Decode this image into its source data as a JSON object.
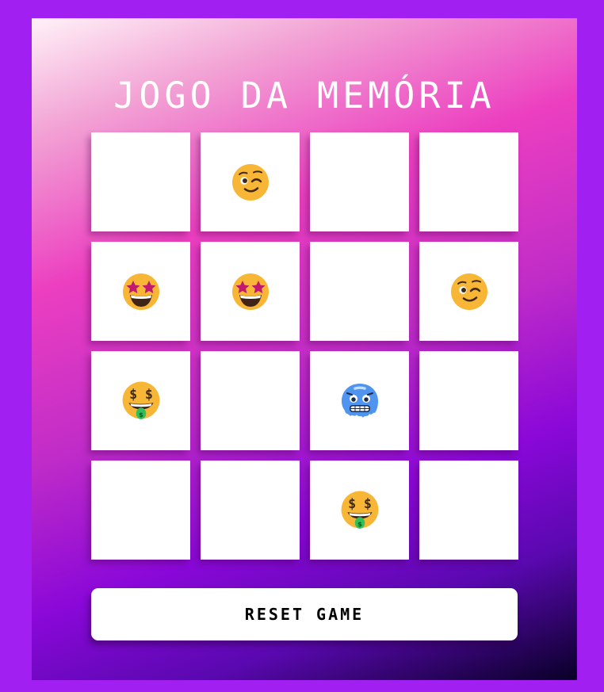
{
  "title": "JOGO DA MEMÓRIA",
  "reset_label": "RESET GAME",
  "emoji_kinds": {
    "wink": "winking-face",
    "star": "star-struck-face",
    "money": "money-mouth-face",
    "cold": "cold-face"
  },
  "cards": [
    {
      "revealed": false,
      "emoji": null
    },
    {
      "revealed": true,
      "emoji": "wink"
    },
    {
      "revealed": false,
      "emoji": null
    },
    {
      "revealed": false,
      "emoji": null
    },
    {
      "revealed": true,
      "emoji": "star"
    },
    {
      "revealed": true,
      "emoji": "star"
    },
    {
      "revealed": false,
      "emoji": null
    },
    {
      "revealed": true,
      "emoji": "wink"
    },
    {
      "revealed": true,
      "emoji": "money"
    },
    {
      "revealed": false,
      "emoji": null
    },
    {
      "revealed": true,
      "emoji": "cold"
    },
    {
      "revealed": false,
      "emoji": null
    },
    {
      "revealed": false,
      "emoji": null
    },
    {
      "revealed": false,
      "emoji": null
    },
    {
      "revealed": true,
      "emoji": "money"
    },
    {
      "revealed": false,
      "emoji": null
    }
  ],
  "colors": {
    "page_background": "#a21ff2",
    "card_face": "#ffffff",
    "title_text": "#ffffff",
    "emoji_yellow": "#f8b636",
    "emoji_blue": "#4f94ee"
  }
}
